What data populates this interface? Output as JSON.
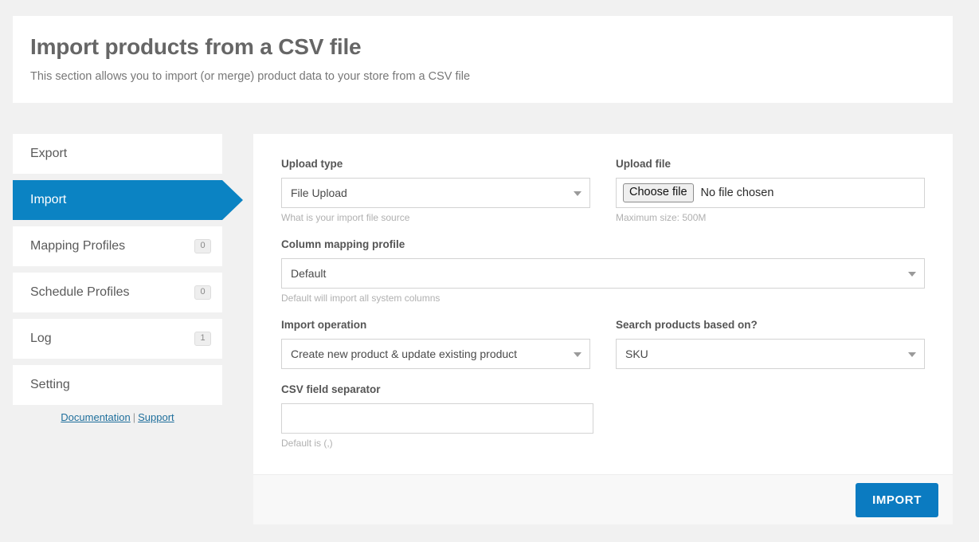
{
  "header": {
    "title": "Import products from a CSV file",
    "subtitle": "This section allows you to import (or merge) product data to your store from a CSV file"
  },
  "sidebar": {
    "items": [
      {
        "label": "Export",
        "badge": "",
        "active": false
      },
      {
        "label": "Import",
        "badge": "",
        "active": true
      },
      {
        "label": "Mapping Profiles",
        "badge": "0",
        "active": false
      },
      {
        "label": "Schedule Profiles",
        "badge": "0",
        "active": false
      },
      {
        "label": "Log",
        "badge": "1",
        "active": false
      },
      {
        "label": "Setting",
        "badge": "",
        "active": false
      }
    ],
    "links": {
      "documentation": "Documentation",
      "separator": "|",
      "support": "Support"
    }
  },
  "form": {
    "upload_type": {
      "label": "Upload type",
      "value": "File Upload",
      "hint": "What is your import file source"
    },
    "upload_file": {
      "label": "Upload file",
      "button": "Choose file",
      "value": "No file chosen",
      "hint": "Maximum size: 500M"
    },
    "column_mapping_profile": {
      "label": "Column mapping profile",
      "value": "Default",
      "hint": "Default will import all system columns"
    },
    "import_operation": {
      "label": "Import operation",
      "value": "Create new product & update existing product",
      "hint": ""
    },
    "search_products_based_on": {
      "label": "Search products based on?",
      "value": "SKU",
      "hint": ""
    },
    "csv_field_separator": {
      "label": "CSV field separator",
      "value": "",
      "placeholder": "",
      "hint": "Default is (,)"
    }
  },
  "footer": {
    "import_label": "IMPORT"
  },
  "colors": {
    "accent": "#0b83c3",
    "button": "#0b7bc1",
    "page_bg": "#f1f1f1"
  }
}
